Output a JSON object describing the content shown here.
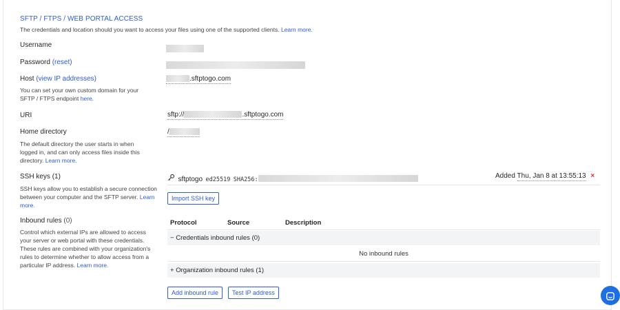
{
  "section": {
    "title": "SFTP / FTPS / WEB PORTAL ACCESS",
    "description": "The credentials and location should you want to access your files using one of the supported clients.",
    "learn_more": "Learn more."
  },
  "username": {
    "label": "Username"
  },
  "password": {
    "label": "Password",
    "reset": "(reset)"
  },
  "host": {
    "label": "Host",
    "view_ip": "(view IP addresses)",
    "help": "You can set your own custom domain for your SFTP / FTPS endpoint",
    "here": "here.",
    "value_suffix": ".sftptogo.com"
  },
  "uri": {
    "label": "URI",
    "prefix": "sftp://",
    "suffix": ".sftptogo.com"
  },
  "home": {
    "label": "Home directory",
    "help": "The default directory the user starts in when logged in, and can only access files inside this directory.",
    "learn_more": "Learn more.",
    "value_prefix": "/"
  },
  "ssh": {
    "label": "SSH keys",
    "count": "(1)",
    "help": "SSH keys allow you to establish a secure connection between your computer and the SFTP server.",
    "learn_more": "Learn more.",
    "key_name": "sftptogo",
    "key_type": "ed25519",
    "key_fp_prefix": "SHA256:",
    "added_label": "Added",
    "added_date": "Thu, Jan 8 at 13:55:13",
    "delete": "×",
    "import_button": "Import SSH key"
  },
  "inbound": {
    "label": "Inbound rules",
    "count": "(0)",
    "help": "Control which external IPs are allowed to access your server or web portal with these credentials. These rules are combined with your organization's rules to determine whether to allow access from a particular IP address.",
    "learn_more": "Learn more.",
    "columns": [
      "Protocol",
      "Source",
      "Description"
    ],
    "credentials_group": {
      "toggle": "−",
      "label": "Credentials inbound rules (0)"
    },
    "no_rules": "No inbound rules",
    "org_group": {
      "toggle": "+",
      "label": "Organization inbound rules (1)"
    },
    "add_button": "Add inbound rule",
    "test_button": "Test IP address"
  },
  "colors": {
    "link": "#2f5bd3",
    "chat": "#1f6fe0",
    "delete": "#d93025"
  }
}
